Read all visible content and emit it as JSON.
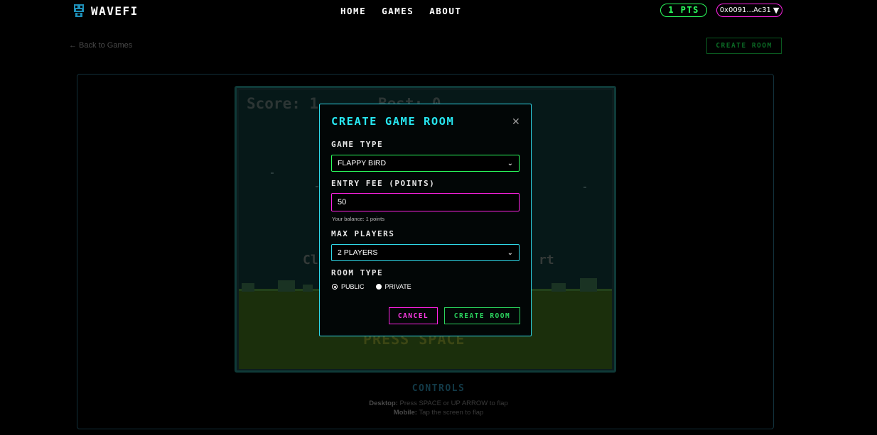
{
  "header": {
    "logo_text": "WAVEFI",
    "nav": [
      "HOME",
      "GAMES",
      "ABOUT"
    ],
    "points": "1 PTS",
    "wallet": "0x0091...Ac31"
  },
  "page": {
    "back_link": "← Back to Games",
    "create_room_button": "CREATE ROOM"
  },
  "game": {
    "score": "Score: 1",
    "best": "Best: 0",
    "hint_left": "Cl",
    "hint_right": "rt",
    "press_text": "PRESS SPACE"
  },
  "controls": {
    "title": "CONTROLS",
    "desktop_label": "Desktop:",
    "desktop_text": " Press SPACE or UP ARROW to flap",
    "mobile_label": "Mobile:",
    "mobile_text": " Tap the screen to flap"
  },
  "modal": {
    "title": "CREATE GAME ROOM",
    "game_type_label": "GAME TYPE",
    "game_type_value": "FLAPPY BIRD",
    "entry_fee_label": "ENTRY FEE (POINTS)",
    "entry_fee_value": "50",
    "balance_note": "Your balance: 1 points",
    "max_players_label": "MAX PLAYERS",
    "max_players_value": "2 PLAYERS",
    "room_type_label": "ROOM TYPE",
    "room_type_options": [
      "PUBLIC",
      "PRIVATE"
    ],
    "room_type_selected": "PUBLIC",
    "cancel_label": "CANCEL",
    "create_label": "CREATE ROOM"
  },
  "colors": {
    "accent_cyan": "#2fd8e8",
    "accent_green": "#2bff5e",
    "accent_pink": "#ff22e5"
  }
}
